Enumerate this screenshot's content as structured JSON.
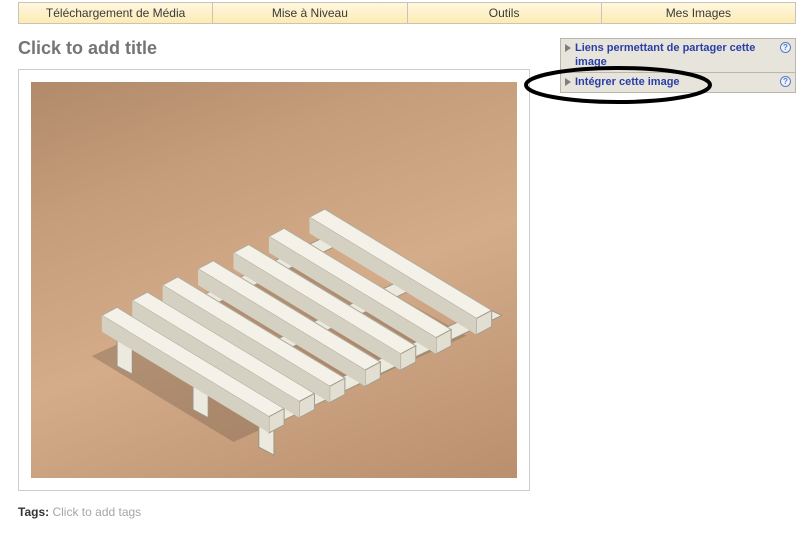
{
  "nav": {
    "tabs": [
      "Téléchargement de Média",
      "Mise à Niveau",
      "Outils",
      "Mes Images"
    ]
  },
  "title": {
    "placeholder": "Click to add title"
  },
  "panels": {
    "share": {
      "label": "Liens permettant de partager cette image"
    },
    "embed": {
      "label": "Intégrer cette image"
    }
  },
  "help_glyph": "?",
  "tags": {
    "label": "Tags:",
    "placeholder": "Click to add tags"
  }
}
